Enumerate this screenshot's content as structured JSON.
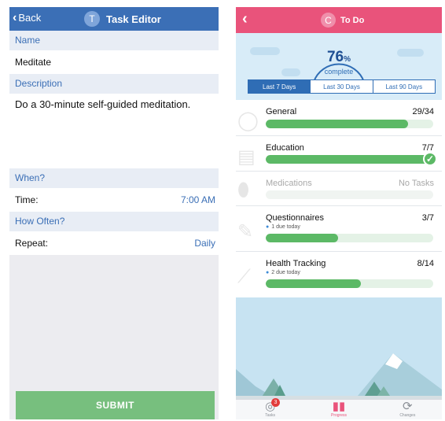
{
  "editor": {
    "nav": {
      "back_label": "Back",
      "avatar_letter": "T",
      "title": "Task Editor"
    },
    "name_header": "Name",
    "name_value": "Meditate",
    "description_header": "Description",
    "description_value": "Do a 30-minute self-guided meditation.",
    "when_header": "When?",
    "time_label": "Time:",
    "time_value": "7:00 AM",
    "how_often_header": "How Often?",
    "repeat_label": "Repeat:",
    "repeat_value": "Daily",
    "submit_label": "SUBMIT",
    "colors": {
      "nav": "#3b6fb6",
      "submit": "#77bf7e"
    }
  },
  "todo": {
    "nav": {
      "avatar_letter": "C",
      "title": "To Do"
    },
    "progress": {
      "percent_number": "76",
      "percent_sign": "%",
      "label": "complete",
      "value": 0.76
    },
    "ranges": [
      "Last 7 Days",
      "Last 30 Days",
      "Last 90 Days"
    ],
    "selected_range": "Last 7 Days",
    "categories": [
      {
        "name": "General",
        "count": "29/34",
        "due": "",
        "progress": 0.85
      },
      {
        "name": "Education",
        "count": "7/7",
        "due": "",
        "progress": 1.0
      },
      {
        "name": "Medications",
        "count": "No Tasks",
        "due": "",
        "progress": 0
      },
      {
        "name": "Questionnaires",
        "count": "3/7",
        "due": "1 due today",
        "progress": 0.43
      },
      {
        "name": "Health Tracking",
        "count": "8/14",
        "due": "2 due today",
        "progress": 0.57
      }
    ],
    "tabs": [
      {
        "label": "Tasks",
        "icon": "tasks-check-icon",
        "badge": "3"
      },
      {
        "label": "Progress",
        "icon": "bar-chart-icon",
        "badge": ""
      },
      {
        "label": "Changes",
        "icon": "refresh-icon",
        "badge": ""
      }
    ],
    "colors": {
      "nav": "#e9537b",
      "accent_blue": "#2f6db5",
      "progress_green": "#5cb966"
    }
  }
}
